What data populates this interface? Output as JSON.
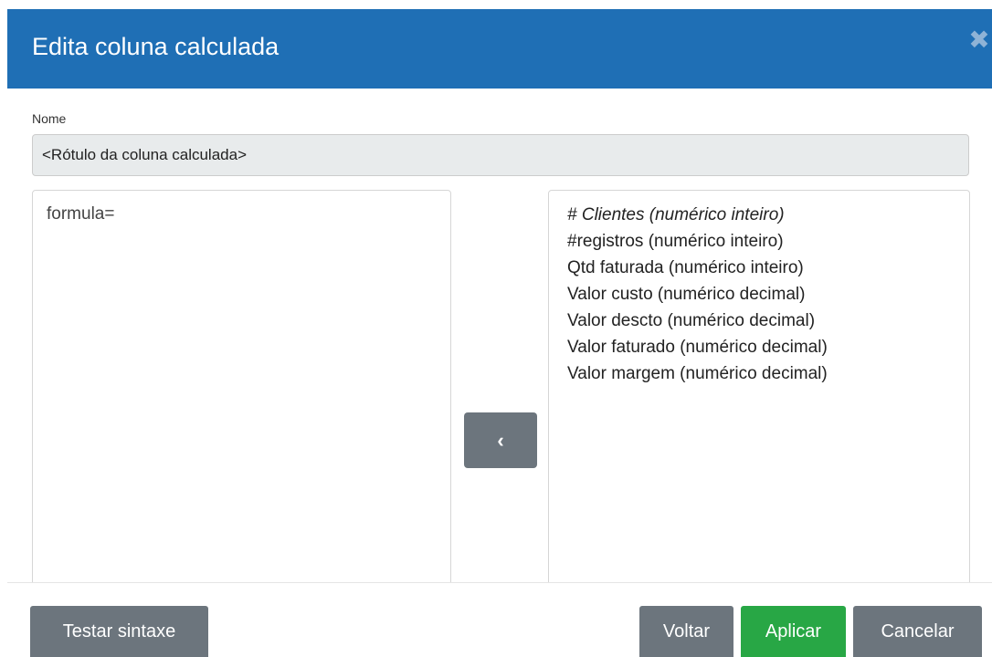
{
  "dialog": {
    "title": "Edita coluna calculada",
    "close_icon": "close-icon"
  },
  "name_field": {
    "label": "Nome",
    "value": "<Rótulo da coluna calculada>"
  },
  "formula": {
    "value": "formula="
  },
  "insert_button": {
    "label": "‹",
    "icon": "chevron-left-icon"
  },
  "fields": [
    {
      "label": "# Clientes (numérico inteiro)",
      "italic": true
    },
    {
      "label": "#registros (numérico inteiro)",
      "italic": false
    },
    {
      "label": "Qtd faturada (numérico inteiro)",
      "italic": false
    },
    {
      "label": "Valor custo (numérico decimal)",
      "italic": false
    },
    {
      "label": "Valor descto (numérico decimal)",
      "italic": false
    },
    {
      "label": "Valor faturado (numérico decimal)",
      "italic": false
    },
    {
      "label": "Valor margem (numérico decimal)",
      "italic": false
    }
  ],
  "footer": {
    "test_label": "Testar sintaxe",
    "back_label": "Voltar",
    "apply_label": "Aplicar",
    "cancel_label": "Cancelar"
  },
  "colors": {
    "header_bg": "#1f6fb5",
    "button_gray": "#6c757d",
    "button_green": "#28a745"
  }
}
